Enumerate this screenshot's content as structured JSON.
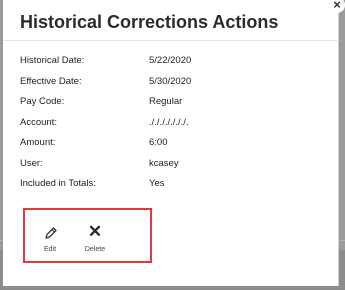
{
  "dialog": {
    "title": "Historical Corrections Actions",
    "close_glyph": "×"
  },
  "fields": [
    {
      "label": "Historical Date:",
      "value": "5/22/2020"
    },
    {
      "label": "Effective Date:",
      "value": "5/30/2020"
    },
    {
      "label": "Pay Code:",
      "value": "Regular"
    },
    {
      "label": "Account:",
      "value": "./././././././."
    },
    {
      "label": "Amount:",
      "value": "6:00"
    },
    {
      "label": "User:",
      "value": "kcasey"
    },
    {
      "label": "Included in Totals:",
      "value": "Yes"
    }
  ],
  "actions": {
    "edit_label": "Edit",
    "edit_icon": "pencil-icon",
    "delete_label": "Delete",
    "delete_icon": "x-icon",
    "delete_glyph": "✕"
  },
  "colors": {
    "highlight_border": "#e0393e",
    "backdrop": "#9a9a9a"
  }
}
